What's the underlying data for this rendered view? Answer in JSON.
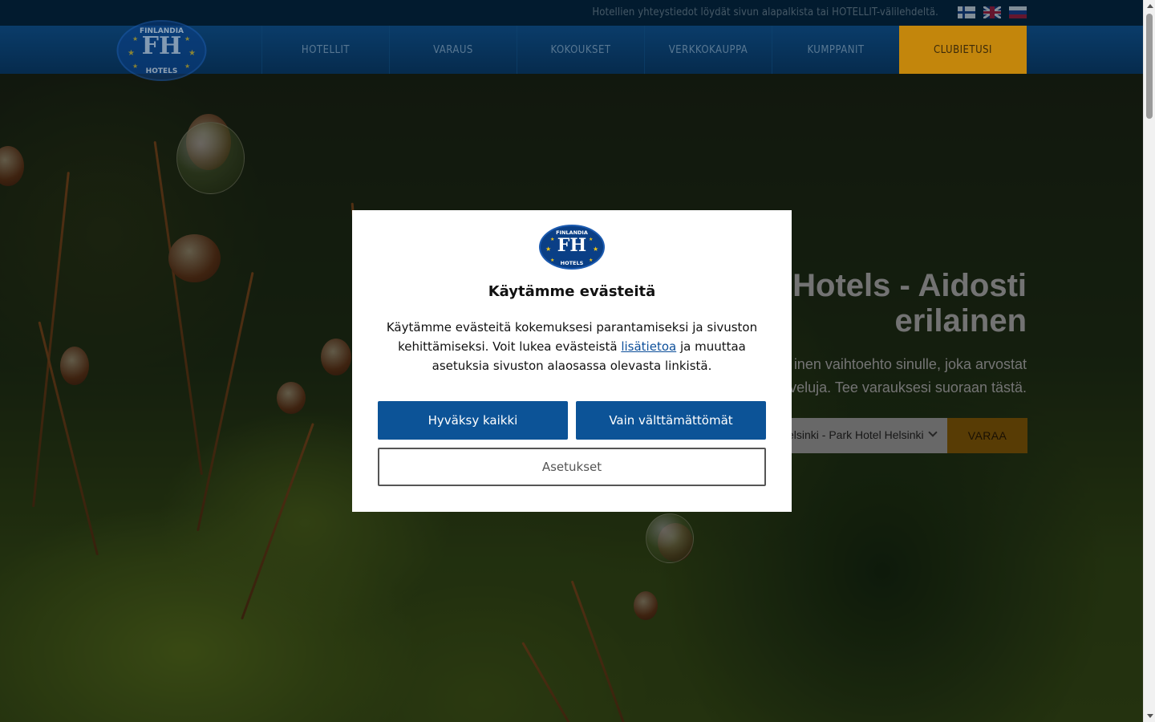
{
  "topbar": {
    "info_text": "Hotellien yhteystiedot löydät sivun alapalkista tai HOTELLIT-välilehdeltä.",
    "languages": [
      {
        "code": "fi",
        "icon": "finnish-flag-icon"
      },
      {
        "code": "en",
        "icon": "uk-flag-icon"
      },
      {
        "code": "ru",
        "icon": "russian-flag-icon"
      }
    ]
  },
  "nav": {
    "logo": {
      "top_text": "FINLANDIA",
      "monogram": "FH",
      "bottom_text": "HOTELS"
    },
    "items": [
      {
        "label": "HOTELLIT"
      },
      {
        "label": "VARAUS"
      },
      {
        "label": "KOKOUKSET"
      },
      {
        "label": "VERKKOKAUPPA"
      },
      {
        "label": "KUMPPANIT"
      },
      {
        "label": "CLUBIETUSI"
      }
    ]
  },
  "hero": {
    "title_line1": "Hotels - Aidosti",
    "title_line2": "erilainen",
    "subtitle_line1": "inen vaihtoehto sinulle, joka arvostat",
    "subtitle_line2": "veluja. Tee varauksesi suoraan tästä.",
    "hotel_select_value": "elsinki - Park Hotel Helsinki",
    "book_button": "VARAA"
  },
  "cookie_dialog": {
    "logo": {
      "top_text": "FINLANDIA",
      "monogram": "FH",
      "bottom_text": "HOTELS"
    },
    "title": "Käytämme evästeitä",
    "text_before_link": "Käytämme evästeitä kokemuksesi parantamiseksi ja sivuston kehittämiseksi. Voit lukea evästeistä ",
    "link_text": "lisätietoa",
    "text_after_link": " ja muuttaa asetuksia sivuston alaosassa olevasta linkistä.",
    "accept_all": "Hyväksy kaikki",
    "essential_only": "Vain välttämättömät",
    "settings": "Asetukset"
  },
  "colors": {
    "topbar_bg": "#021b2f",
    "nav_bg": "#0a3c6a",
    "accent_orange": "#c3860c",
    "primary_button": "#0c5397",
    "link": "#0d4f9a"
  }
}
